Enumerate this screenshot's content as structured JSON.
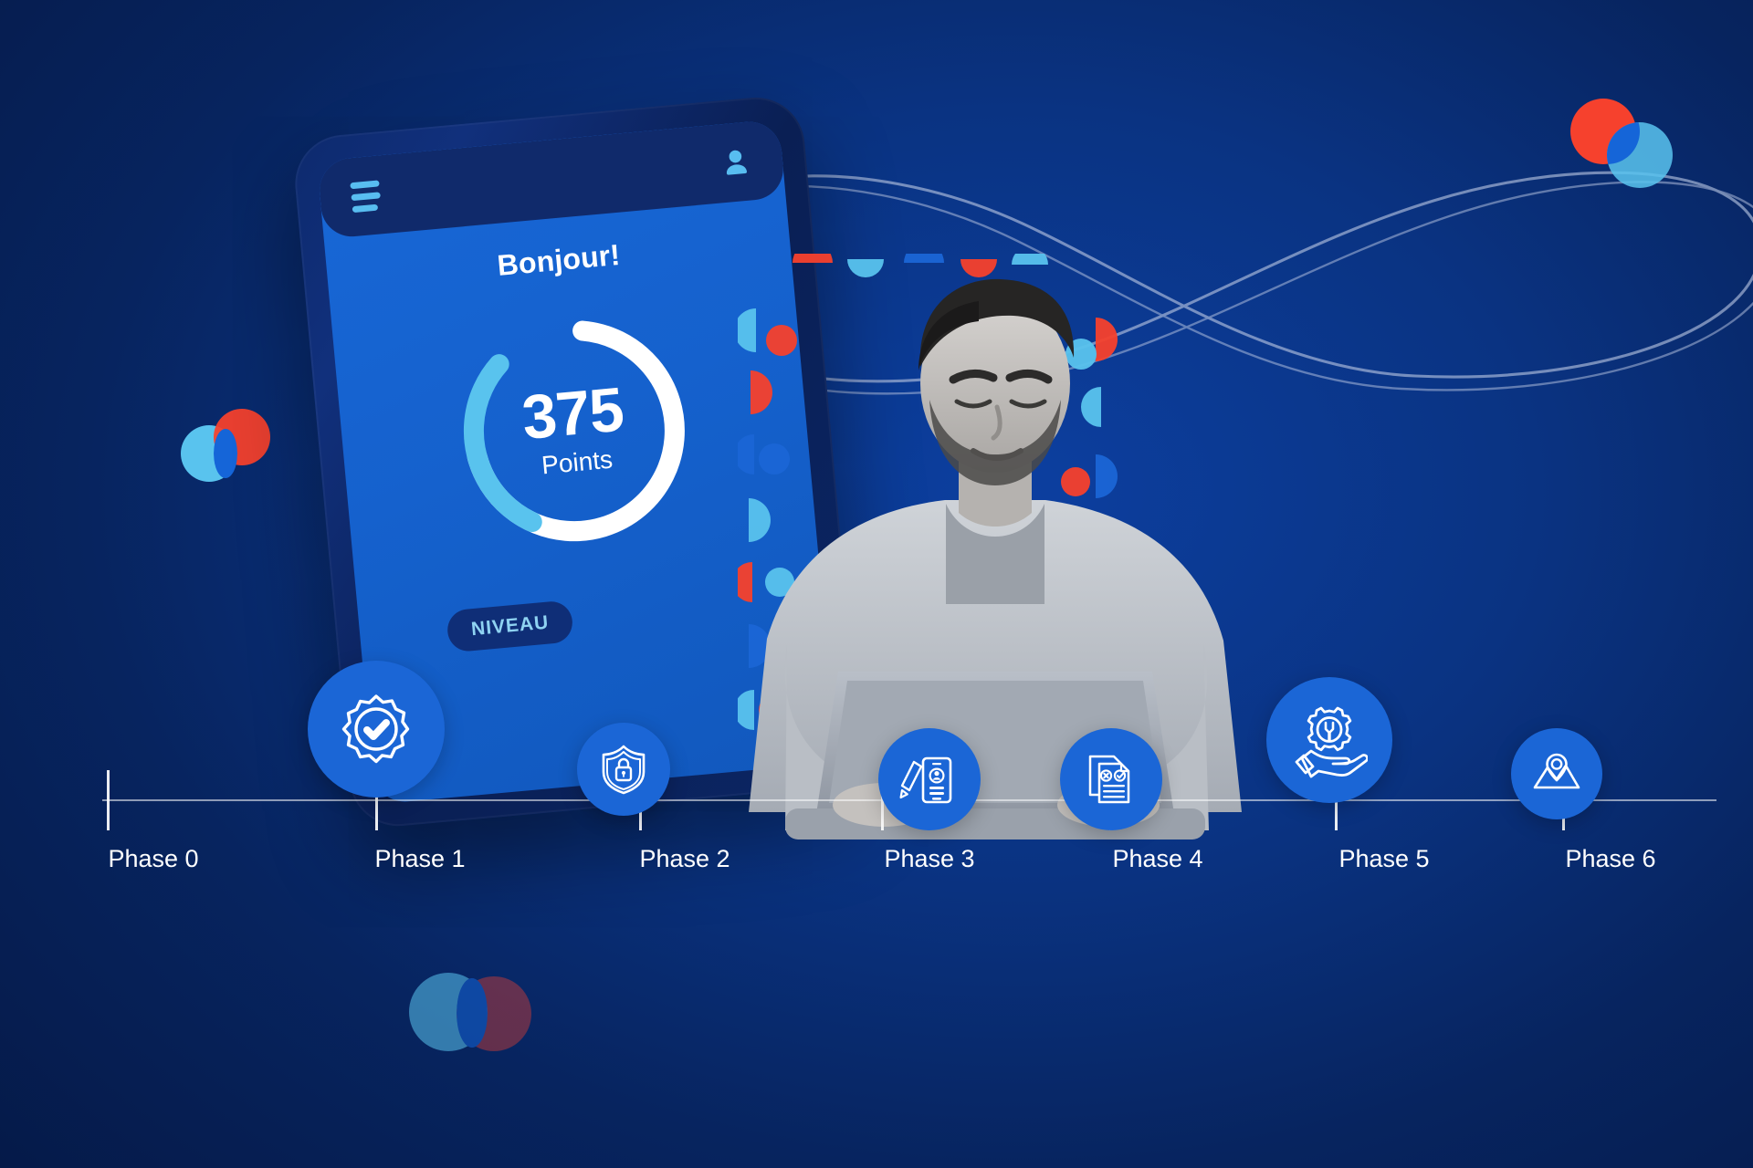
{
  "theme": {
    "bg_deep": "#051a49",
    "bg_mid": "#0a3382",
    "accent_blue": "#1b66d6",
    "light_blue": "#59c3ee",
    "red": "#f6412d",
    "white": "#ffffff"
  },
  "phone": {
    "menu_icon": "hamburger-menu-icon",
    "account_icon": "user-avatar-icon",
    "greeting": "Bonjour!",
    "points_value": "375",
    "points_label": "Points",
    "level_badge": "NIVEAU",
    "ring": {
      "progress_percent": 72,
      "track_color": "#ffffff",
      "progress_color": "#59c3ee"
    }
  },
  "timeline": {
    "phases": [
      {
        "label": "Phase 0",
        "icon": "certified-badge-check-icon",
        "has_node": true
      },
      {
        "label": "Phase 1",
        "icon": "none",
        "has_node": false
      },
      {
        "label": "Phase 2",
        "icon": "shield-lock-icon",
        "has_node": true
      },
      {
        "label": "Phase 3",
        "icon": "profile-form-pencil-icon",
        "has_node": true
      },
      {
        "label": "Phase 4",
        "icon": "documents-approve-reject-icon",
        "has_node": true
      },
      {
        "label": "Phase 5",
        "icon": "hand-gear-wrench-support-icon",
        "has_node": true
      },
      {
        "label": "Phase 6",
        "icon": "map-location-pin-icon",
        "has_node": true
      }
    ]
  },
  "decorations": {
    "infinity_ribbon": "infinity-loop-line-art",
    "venn_top_right": {
      "icon": "overlapping-circles-icon",
      "colors": [
        "#f6412d",
        "#59c3ee"
      ]
    },
    "venn_left": {
      "icon": "overlapping-circles-icon",
      "colors": [
        "#59c3ee",
        "#f6412d"
      ]
    },
    "venn_bottom": {
      "icon": "overlapping-circles-icon-muted",
      "colors": [
        "#59c3ee",
        "#f6412d"
      ]
    }
  },
  "photo": {
    "subject": "man-working-on-laptop-photo",
    "treatment": "black-and-white"
  }
}
